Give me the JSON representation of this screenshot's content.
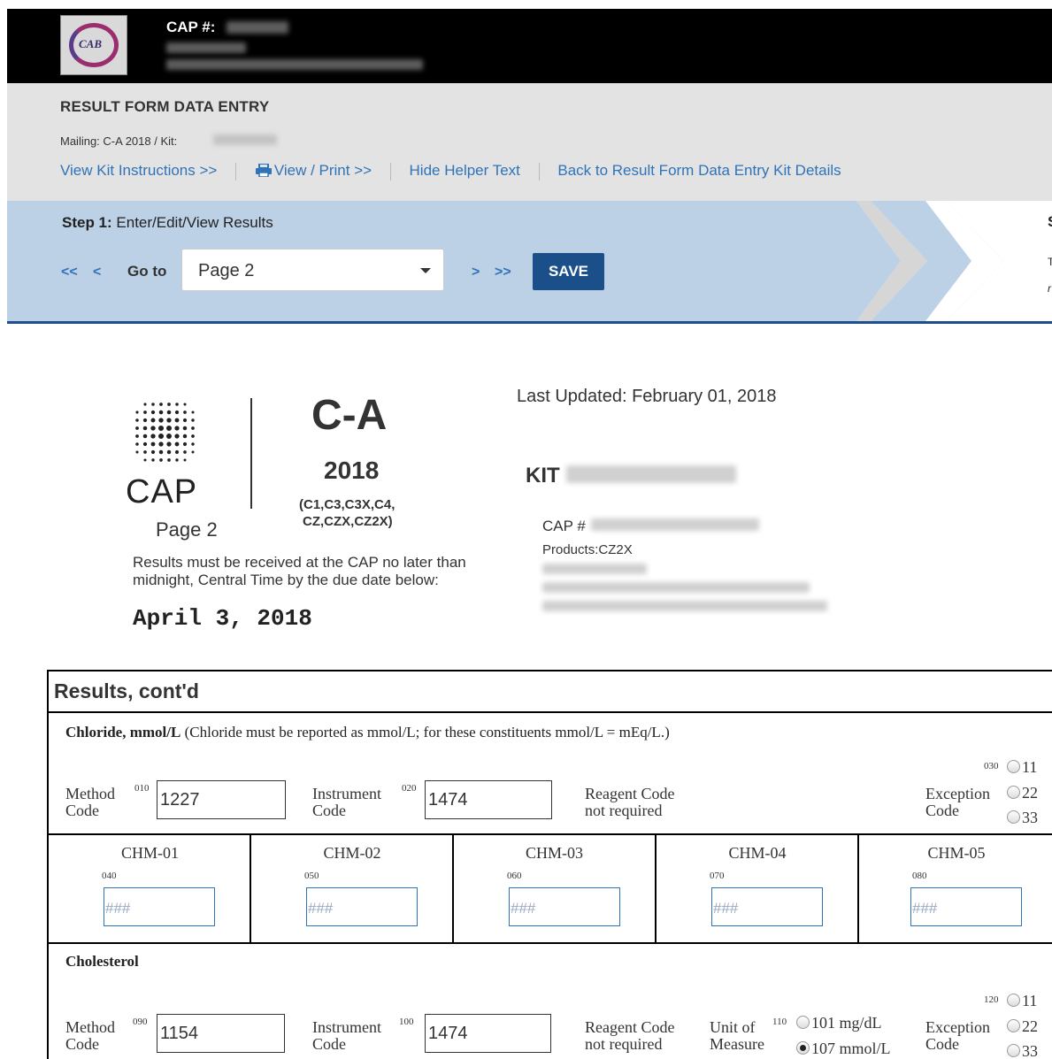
{
  "header": {
    "cap_label": "CAP #:",
    "logo_text": "CAB"
  },
  "subheader": {
    "title": "RESULT FORM DATA ENTRY",
    "mailing": "Mailing: C-A 2018 / Kit:",
    "links": {
      "view_kit": "View Kit Instructions >>",
      "view_print": "View / Print >>",
      "hide_helper": "Hide Helper Text",
      "back": "Back to Result Form Data Entry Kit Details"
    }
  },
  "step": {
    "label_bold": "Step 1:",
    "label": " Enter/Edit/View Results",
    "first": "<<",
    "prev": "<",
    "goto": "Go to",
    "page_select": "Page 2",
    "next": ">",
    "last": ">>",
    "save": "SAVE",
    "edge1": "S",
    "edge2": "T",
    "edge3": "r"
  },
  "form_header": {
    "cap_word": "CAP",
    "page": "Page 2",
    "survey": "C-A",
    "year": "2018",
    "products_line1": "(C1,C3,C3X,C4,",
    "products_line2": "CZ,CZX,CZ2X)",
    "note": "Results must be received at the CAP no later than midnight, Central Time by the due date below:",
    "due_date": "April 3, 2018",
    "last_updated": "Last Updated: February 01, 2018",
    "kit_label": "KIT",
    "cap_hash": "CAP #",
    "products": "Products:CZ2X"
  },
  "results": {
    "title": "Results, cont'd",
    "chloride": {
      "name": "Chloride, mmol/L",
      "note": " (Chloride must be reported as mmol/L; for these constituents mmol/L = mEq/L.)",
      "method_label_1": "Method",
      "method_label_2": "Code",
      "method_num": "010",
      "method_value": "1227",
      "instrument_label_1": "Instrument",
      "instrument_label_2": "Code",
      "instrument_num": "020",
      "instrument_value": "1474",
      "reagent_1": "Reagent Code",
      "reagent_2": "not required",
      "exception_label_1": "Exception",
      "exception_label_2": "Code",
      "exception_num": "030",
      "exception_options": [
        "11",
        "22",
        "33"
      ]
    },
    "chm": [
      {
        "title": "CHM-01",
        "num": "040",
        "placeholder": "###"
      },
      {
        "title": "CHM-02",
        "num": "050",
        "placeholder": "###"
      },
      {
        "title": "CHM-03",
        "num": "060",
        "placeholder": "###"
      },
      {
        "title": "CHM-04",
        "num": "070",
        "placeholder": "###"
      },
      {
        "title": "CHM-05",
        "num": "080",
        "placeholder": "###"
      }
    ],
    "cholesterol": {
      "name": "Cholesterol",
      "method_label_1": "Method",
      "method_label_2": "Code",
      "method_num": "090",
      "method_value": "1154",
      "instrument_label_1": "Instrument",
      "instrument_label_2": "Code",
      "instrument_num": "100",
      "instrument_value": "1474",
      "reagent_1": "Reagent Code",
      "reagent_2": "not required",
      "unit_label_1": "Unit of",
      "unit_label_2": "Measure",
      "unit_num": "110",
      "unit_options": [
        "101 mg/dL",
        "107 mmol/L"
      ],
      "unit_selected": "107 mmol/L",
      "exception_label_1": "Exception",
      "exception_label_2": "Code",
      "exception_num": "120",
      "exception_options": [
        "11",
        "22",
        "33"
      ]
    }
  },
  "colors": {
    "link": "#2f73b8",
    "save_button": "#1a4f8a",
    "step_bg": "#bcd0e6",
    "header_bg": "#000000",
    "subheader_bg": "#e3e3e3"
  }
}
